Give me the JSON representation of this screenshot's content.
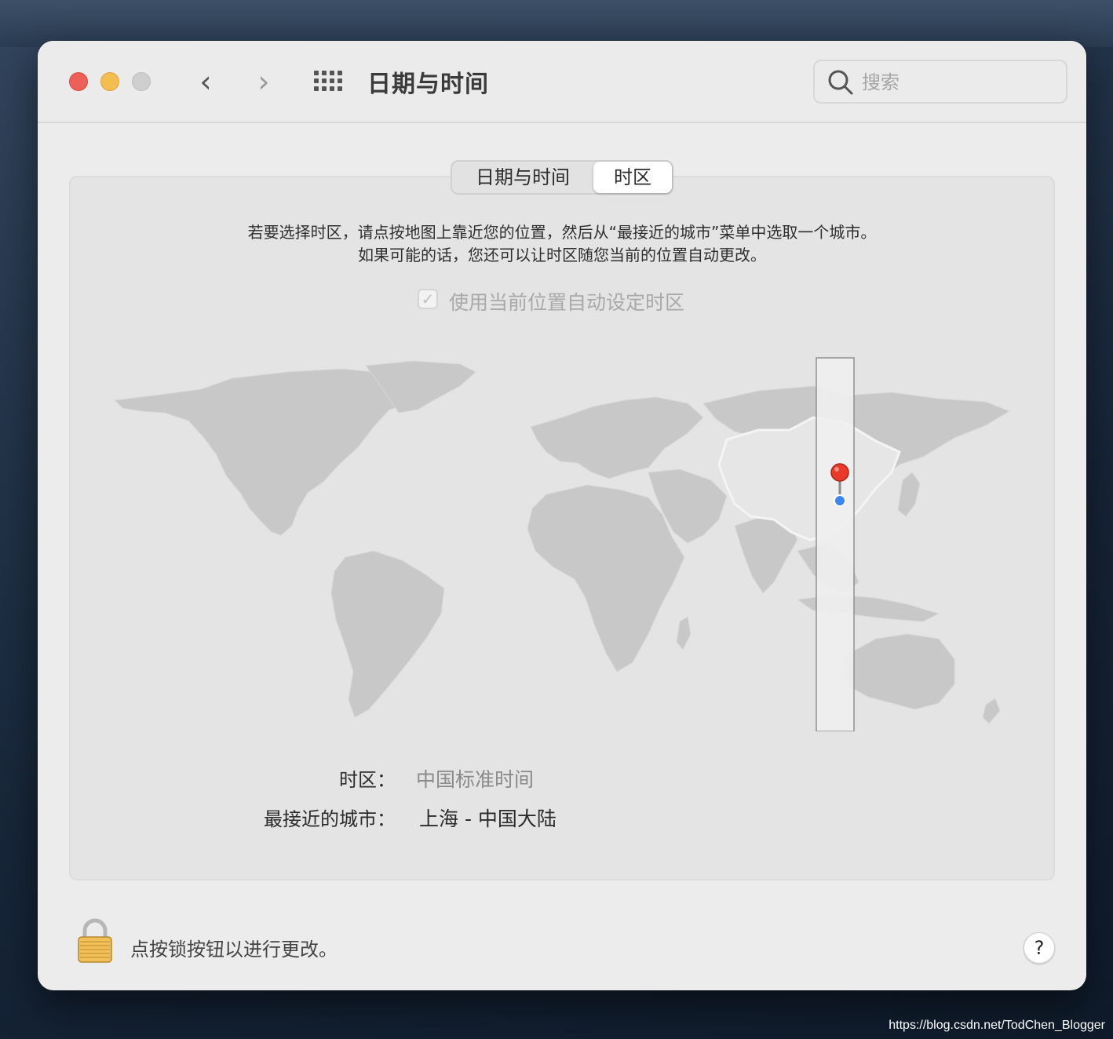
{
  "window": {
    "title": "日期与时间"
  },
  "search": {
    "placeholder": "搜索"
  },
  "tabs": [
    {
      "label": "日期与时间",
      "selected": false
    },
    {
      "label": "时区",
      "selected": true
    }
  ],
  "description": {
    "line1": "若要选择时区，请点按地图上靠近您的位置，然后从“最接近的城市”菜单中选取一个城市。",
    "line2": "如果可能的话，您还可以让时区随您当前的位置自动更改。"
  },
  "auto_timezone": {
    "label": "使用当前位置自动设定时区",
    "checked": true,
    "enabled": false
  },
  "timezone": {
    "label": "时区：",
    "value": "中国标准时间"
  },
  "closest_city": {
    "label": "最接近的城市：",
    "value": "上海 - 中国大陆"
  },
  "footer": {
    "lock_text": "点按锁按钮以进行更改。",
    "help_label": "?"
  },
  "watermark": "https://blog.csdn.net/TodChen_Blogger",
  "colors": {
    "close": "#ee5f57",
    "minimize": "#f4bd4f",
    "zoom": "#cfcfcf",
    "pin": "#e8392a",
    "location_dot": "#3a86f5"
  },
  "icons": {
    "back": "chevron-left-icon",
    "forward": "chevron-right-icon",
    "show_all": "grid-icon",
    "search": "search-icon",
    "lock": "lock-icon",
    "help": "help-icon",
    "pin": "map-pin-icon"
  }
}
